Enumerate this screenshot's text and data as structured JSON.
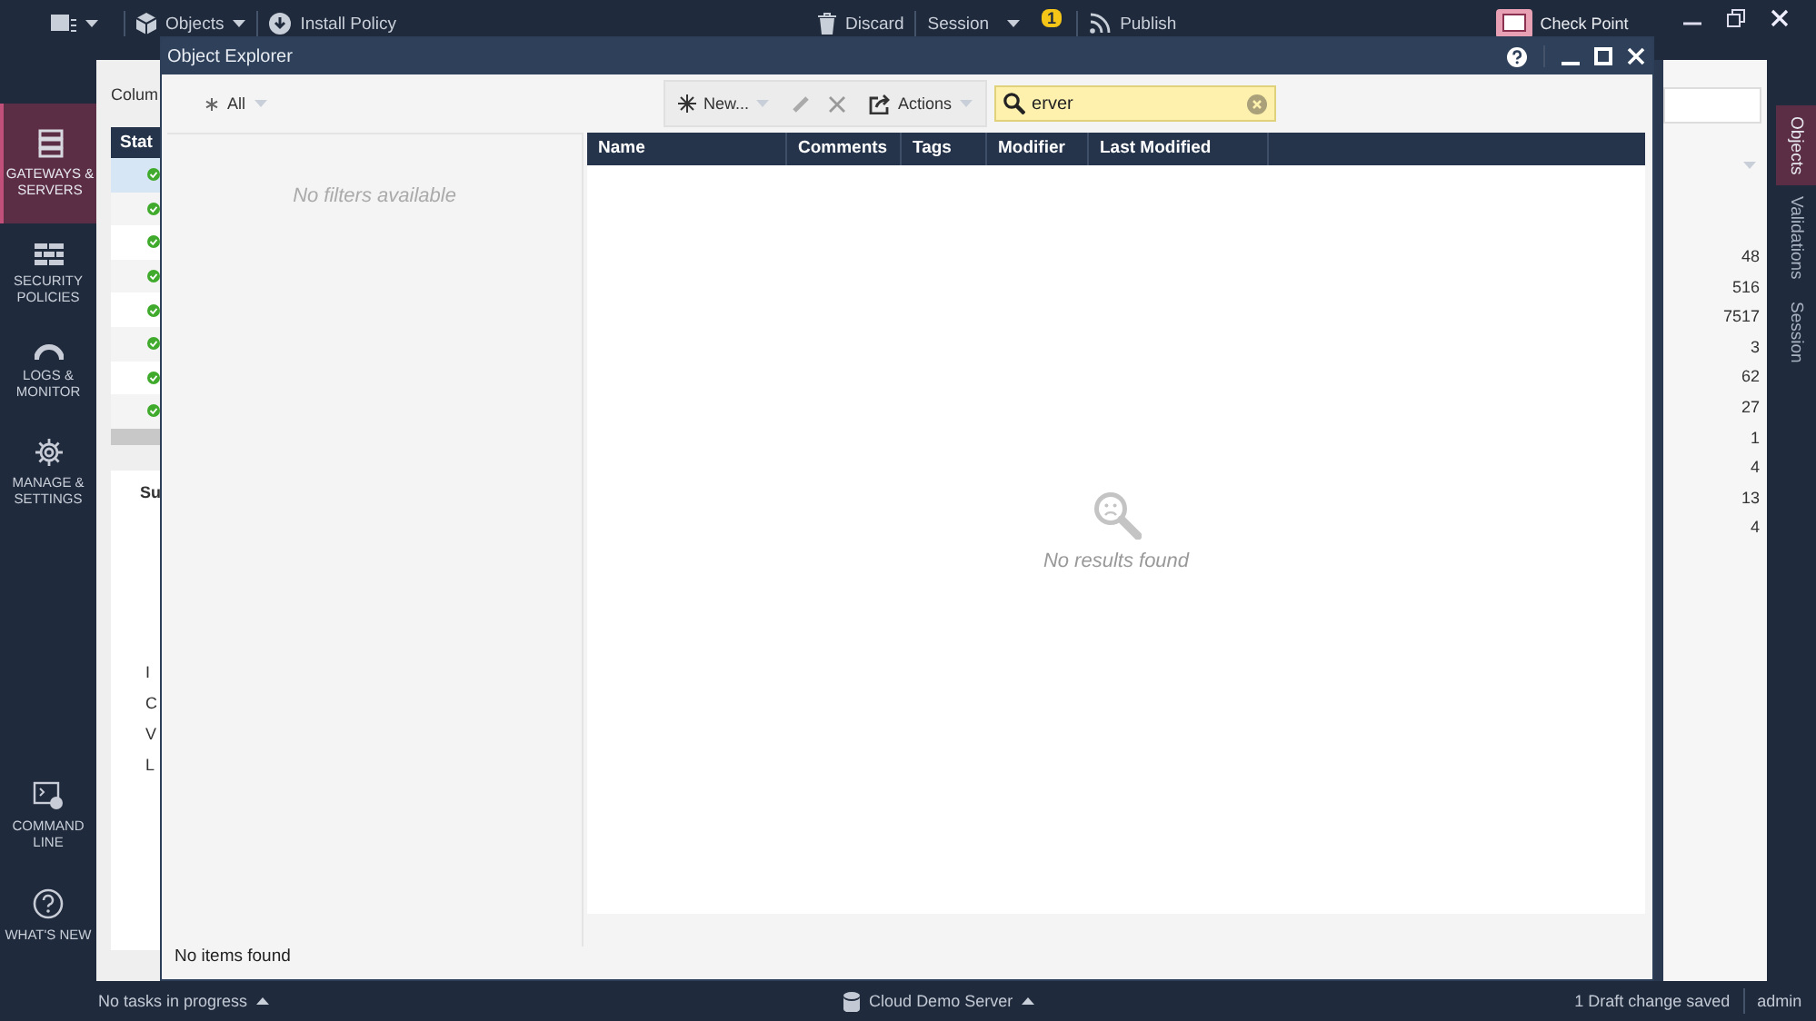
{
  "top_bar": {
    "objects_menu": "Objects",
    "install_policy": "Install Policy",
    "discard": "Discard",
    "session": "Session",
    "session_badge": "1",
    "publish": "Publish",
    "brand": "Check Point"
  },
  "nav": {
    "items": [
      {
        "kind": "servers",
        "label": "GATEWAYS & SERVERS",
        "selected": true
      },
      {
        "kind": "policies",
        "label": "SECURITY POLICIES",
        "selected": false
      },
      {
        "kind": "logs",
        "label": "LOGS & MONITOR",
        "selected": false
      },
      {
        "kind": "settings",
        "label": "MANAGE & SETTINGS",
        "selected": false
      }
    ],
    "bottom_items": [
      {
        "kind": "command",
        "label": "COMMAND LINE"
      },
      {
        "kind": "help",
        "label": "WHAT'S NEW"
      }
    ]
  },
  "background": {
    "columns_label": "Colum",
    "table_header": "Stat",
    "rows": [
      {
        "selected": true
      },
      {
        "selected": false
      },
      {
        "selected": false
      },
      {
        "selected": false
      },
      {
        "selected": false
      },
      {
        "selected": false
      },
      {
        "selected": false
      },
      {
        "selected": false
      }
    ],
    "tab": "Su",
    "labels": [
      "I",
      "C",
      "V",
      "L"
    ]
  },
  "right_panel": {
    "counts": [
      "48",
      "516",
      "7517",
      "3",
      "62",
      "27",
      "1",
      "4",
      "13",
      "4"
    ]
  },
  "side_tabs": [
    {
      "label": "Objects",
      "selected": true
    },
    {
      "label": "Validations",
      "selected": false
    },
    {
      "label": "Session",
      "selected": false
    }
  ],
  "dialog": {
    "title": "Object Explorer",
    "filter": "All",
    "new_button": "New...",
    "actions_button": "Actions",
    "search": {
      "value": "erver"
    },
    "filters_message": "No filters available",
    "columns": [
      "Name",
      "Comments",
      "Tags",
      "Modifier",
      "Last Modified"
    ],
    "empty_message": "No results found",
    "footer": "No items found"
  },
  "status_bar": {
    "tasks": "No tasks in progress",
    "server": "Cloud Demo Server",
    "drafts": "1 Draft change saved",
    "user": "admin"
  }
}
